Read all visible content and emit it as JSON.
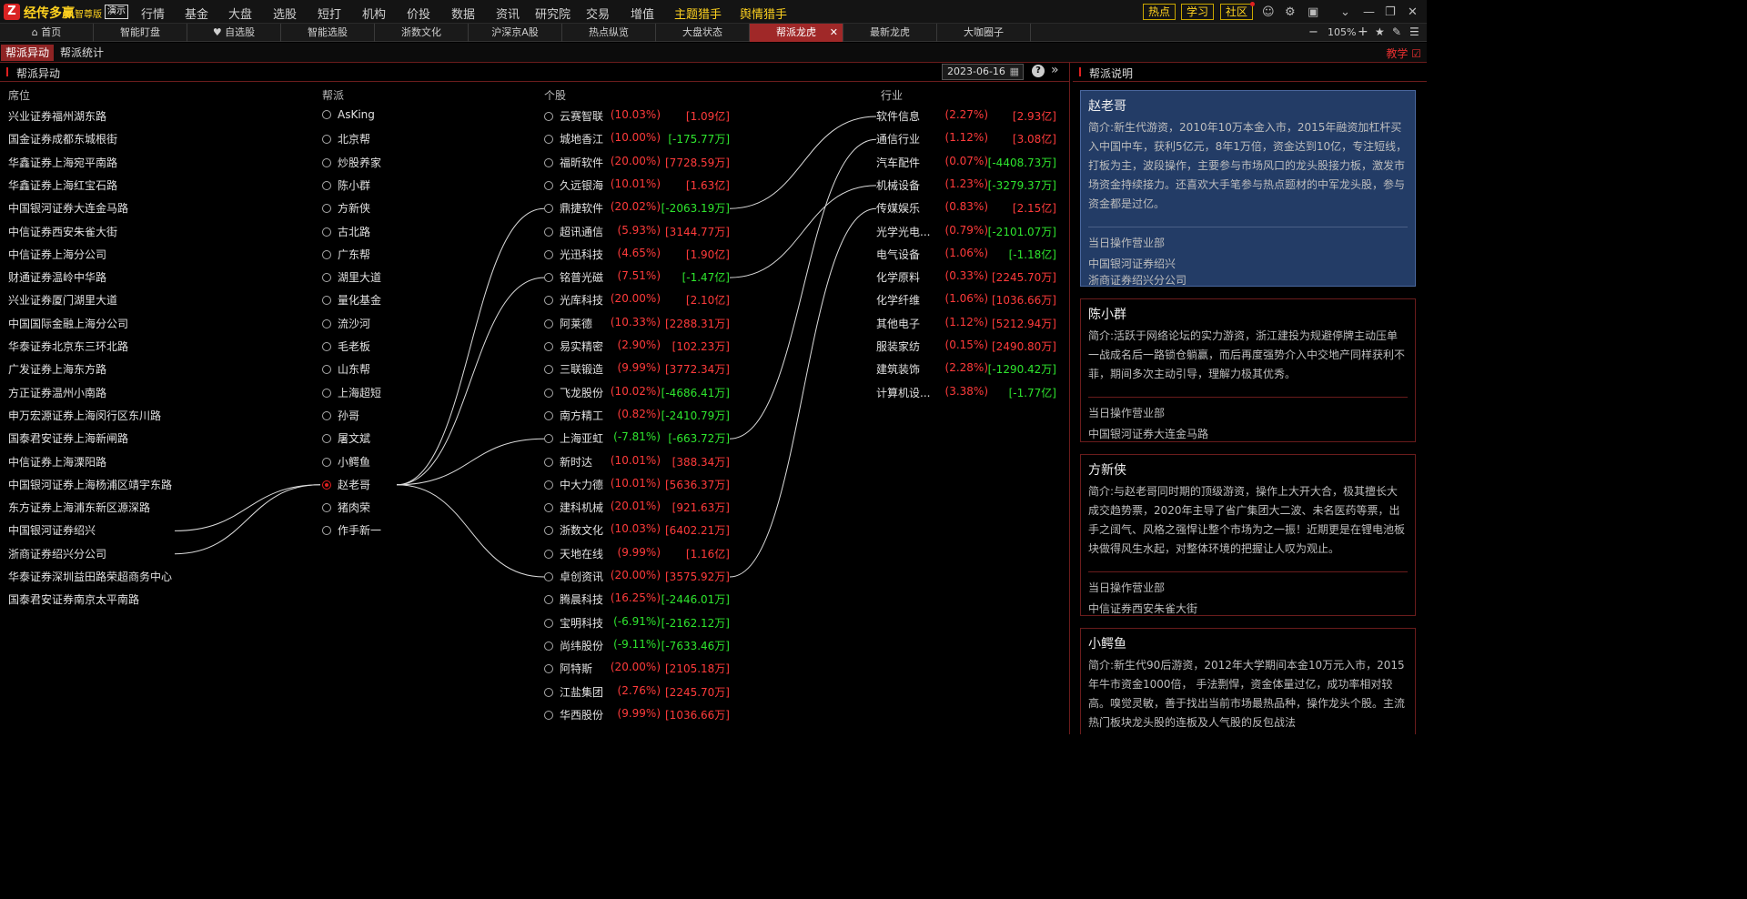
{
  "app": {
    "logo": "Z",
    "name": "经传多赢",
    "version": "智尊版",
    "demo": "演示"
  },
  "menu": [
    {
      "label": "行情",
      "dot": true
    },
    {
      "label": "基金"
    },
    {
      "label": "大盘"
    },
    {
      "label": "选股"
    },
    {
      "label": "短打"
    },
    {
      "label": "机构"
    },
    {
      "label": "价投"
    },
    {
      "label": "数据"
    },
    {
      "label": "资讯"
    },
    {
      "label": "研究院"
    },
    {
      "label": "交易"
    },
    {
      "label": "增值",
      "dot": true
    },
    {
      "label": "主题猎手",
      "dot": true,
      "yellow": true
    },
    {
      "label": "舆情猎手",
      "dot": true,
      "yellow": true
    }
  ],
  "top_buttons": [
    {
      "label": "热点"
    },
    {
      "label": "学习"
    },
    {
      "label": "社区",
      "dot": true
    }
  ],
  "tabs": [
    {
      "label": "首页"
    },
    {
      "label": "智能盯盘"
    },
    {
      "label": "自选股"
    },
    {
      "label": "智能选股"
    },
    {
      "label": "浙数文化"
    },
    {
      "label": "沪深京A股"
    },
    {
      "label": "热点纵览"
    },
    {
      "label": "大盘状态"
    },
    {
      "label": "帮派龙虎",
      "active": true
    },
    {
      "label": "最新龙虎"
    },
    {
      "label": "大咖圈子"
    }
  ],
  "zoom": "105%",
  "subtabs": [
    {
      "label": "帮派异动",
      "active": true
    },
    {
      "label": "帮派统计"
    }
  ],
  "teach_label": "教学",
  "panel": {
    "title": "帮派异动",
    "date": "2023-06-16",
    "col_seat": "席位",
    "col_gang": "帮派",
    "col_stock": "个股",
    "col_industry": "行业"
  },
  "seats": [
    "兴业证券福州湖东路",
    "国金证券成都东城根街",
    "华鑫证券上海宛平南路",
    "华鑫证券上海红宝石路",
    "中国银河证券大连金马路",
    "中信证券西安朱雀大街",
    "中信证券上海分公司",
    "财通证券温岭中华路",
    "兴业证券厦门湖里大道",
    "中国国际金融上海分公司",
    "华泰证券北京东三环北路",
    "广发证券上海东方路",
    "方正证券温州小南路",
    "申万宏源证券上海闵行区东川路",
    "国泰君安证券上海新闸路",
    "中信证券上海溧阳路",
    "中国银河证券上海杨浦区靖宇东路",
    "东方证券上海浦东新区源深路",
    "中国银河证券绍兴",
    "浙商证券绍兴分公司",
    "华泰证券深圳益田路荣超商务中心",
    "国泰君安证券南京太平南路"
  ],
  "gangs": [
    {
      "name": "AsKing"
    },
    {
      "name": "北京帮"
    },
    {
      "name": "炒股养家"
    },
    {
      "name": "陈小群"
    },
    {
      "name": "方新侠"
    },
    {
      "name": "古北路"
    },
    {
      "name": "广东帮"
    },
    {
      "name": "湖里大道"
    },
    {
      "name": "量化基金"
    },
    {
      "name": "流沙河"
    },
    {
      "name": "毛老板"
    },
    {
      "name": "山东帮"
    },
    {
      "name": "上海超短"
    },
    {
      "name": "孙哥"
    },
    {
      "name": "屠文斌"
    },
    {
      "name": "小鳄鱼"
    },
    {
      "name": "赵老哥",
      "selected": true
    },
    {
      "name": "猪肉荣"
    },
    {
      "name": "作手新一"
    }
  ],
  "stocks": [
    {
      "name": "云赛智联",
      "pct": "(10.03%)",
      "amt": "[1.09亿]",
      "pc": "red",
      "ac": "red"
    },
    {
      "name": "城地香江",
      "pct": "(10.00%)",
      "amt": "[-175.77万]",
      "pc": "red",
      "ac": "green"
    },
    {
      "name": "福昕软件",
      "pct": "(20.00%)",
      "amt": "[7728.59万]",
      "pc": "red",
      "ac": "red"
    },
    {
      "name": "久远银海",
      "pct": "(10.01%)",
      "amt": "[1.63亿]",
      "pc": "red",
      "ac": "red"
    },
    {
      "name": "鼎捷软件",
      "pct": "(20.02%)",
      "amt": "[-2063.19万]",
      "pc": "red",
      "ac": "green"
    },
    {
      "name": "超讯通信",
      "pct": "(5.93%)",
      "amt": "[3144.77万]",
      "pc": "red",
      "ac": "red"
    },
    {
      "name": "光迅科技",
      "pct": "(4.65%)",
      "amt": "[1.90亿]",
      "pc": "red",
      "ac": "red"
    },
    {
      "name": "铭普光磁",
      "pct": "(7.51%)",
      "amt": "[-1.47亿]",
      "pc": "red",
      "ac": "green"
    },
    {
      "name": "光库科技",
      "pct": "(20.00%)",
      "amt": "[2.10亿]",
      "pc": "red",
      "ac": "red"
    },
    {
      "name": "阿莱德",
      "pct": "(10.33%)",
      "amt": "[2288.31万]",
      "pc": "red",
      "ac": "red"
    },
    {
      "name": "易实精密",
      "pct": "(2.90%)",
      "amt": "[102.23万]",
      "pc": "red",
      "ac": "red"
    },
    {
      "name": "三联锻造",
      "pct": "(9.99%)",
      "amt": "[3772.34万]",
      "pc": "red",
      "ac": "red"
    },
    {
      "name": "飞龙股份",
      "pct": "(10.02%)",
      "amt": "[-4686.41万]",
      "pc": "red",
      "ac": "green"
    },
    {
      "name": "南方精工",
      "pct": "(0.82%)",
      "amt": "[-2410.79万]",
      "pc": "red",
      "ac": "green"
    },
    {
      "name": "上海亚虹",
      "pct": "(-7.81%)",
      "amt": "[-663.72万]",
      "pc": "green",
      "ac": "green"
    },
    {
      "name": "新时达",
      "pct": "(10.01%)",
      "amt": "[388.34万]",
      "pc": "red",
      "ac": "red"
    },
    {
      "name": "中大力德",
      "pct": "(10.01%)",
      "amt": "[5636.37万]",
      "pc": "red",
      "ac": "red"
    },
    {
      "name": "建科机械",
      "pct": "(20.01%)",
      "amt": "[921.63万]",
      "pc": "red",
      "ac": "red"
    },
    {
      "name": "浙数文化",
      "pct": "(10.03%)",
      "amt": "[6402.21万]",
      "pc": "red",
      "ac": "red"
    },
    {
      "name": "天地在线",
      "pct": "(9.99%)",
      "amt": "[1.16亿]",
      "pc": "red",
      "ac": "red"
    },
    {
      "name": "卓创资讯",
      "pct": "(20.00%)",
      "amt": "[3575.92万]",
      "pc": "red",
      "ac": "red"
    },
    {
      "name": "腾晨科技",
      "pct": "(16.25%)",
      "amt": "[-2446.01万]",
      "pc": "red",
      "ac": "green"
    },
    {
      "name": "宝明科技",
      "pct": "(-6.91%)",
      "amt": "[-2162.12万]",
      "pc": "green",
      "ac": "green"
    },
    {
      "name": "尚纬股份",
      "pct": "(-9.11%)",
      "amt": "[-7633.46万]",
      "pc": "green",
      "ac": "green"
    },
    {
      "name": "阿特斯",
      "pct": "(20.00%)",
      "amt": "[2105.18万]",
      "pc": "red",
      "ac": "red"
    },
    {
      "name": "江盐集团",
      "pct": "(2.76%)",
      "amt": "[2245.70万]",
      "pc": "red",
      "ac": "red"
    },
    {
      "name": "华西股份",
      "pct": "(9.99%)",
      "amt": "[1036.66万]",
      "pc": "red",
      "ac": "red"
    }
  ],
  "industries": [
    {
      "name": "软件信息",
      "pct": "(2.27%)",
      "amt": "[2.93亿]",
      "pc": "red",
      "ac": "red"
    },
    {
      "name": "通信行业",
      "pct": "(1.12%)",
      "amt": "[3.08亿]",
      "pc": "red",
      "ac": "red"
    },
    {
      "name": "汽车配件",
      "pct": "(0.07%)",
      "amt": "[-4408.73万]",
      "pc": "red",
      "ac": "green"
    },
    {
      "name": "机械设备",
      "pct": "(1.23%)",
      "amt": "[-3279.37万]",
      "pc": "red",
      "ac": "green"
    },
    {
      "name": "传媒娱乐",
      "pct": "(0.83%)",
      "amt": "[2.15亿]",
      "pc": "red",
      "ac": "red"
    },
    {
      "name": "光学光电...",
      "pct": "(0.79%)",
      "amt": "[-2101.07万]",
      "pc": "red",
      "ac": "green"
    },
    {
      "name": "电气设备",
      "pct": "(1.06%)",
      "amt": "[-1.18亿]",
      "pc": "red",
      "ac": "green"
    },
    {
      "name": "化学原料",
      "pct": "(0.33%)",
      "amt": "[2245.70万]",
      "pc": "red",
      "ac": "red"
    },
    {
      "name": "化学纤维",
      "pct": "(1.06%)",
      "amt": "[1036.66万]",
      "pc": "red",
      "ac": "red"
    },
    {
      "name": "其他电子",
      "pct": "(1.12%)",
      "amt": "[5212.94万]",
      "pc": "red",
      "ac": "red"
    },
    {
      "name": "服装家纺",
      "pct": "(0.15%)",
      "amt": "[2490.80万]",
      "pc": "red",
      "ac": "red"
    },
    {
      "name": "建筑装饰",
      "pct": "(2.28%)",
      "amt": "[-1290.42万]",
      "pc": "red",
      "ac": "green"
    },
    {
      "name": "计算机设...",
      "pct": "(3.38%)",
      "amt": "[-1.77亿]",
      "pc": "red",
      "ac": "green"
    }
  ],
  "links": {
    "seat_to_gang": [
      [
        18,
        16
      ],
      [
        19,
        16
      ]
    ],
    "gang_to_stock": [
      [
        16,
        4
      ],
      [
        16,
        7
      ],
      [
        16,
        14
      ],
      [
        16,
        20
      ]
    ],
    "stock_to_ind": [
      [
        4,
        0
      ],
      [
        7,
        3
      ],
      [
        14,
        1
      ],
      [
        20,
        4
      ]
    ]
  },
  "right": {
    "title": "帮派说明",
    "dept_label": "当日操作营业部",
    "cards": [
      {
        "name": "赵老哥",
        "intro": "简介:新生代游资，2010年10万本金入市，2015年融资加杠杆买入中国中车，获利5亿元，8年1万倍，资金达到10亿，专注短线，打板为主，波段操作，主要参与市场风口的龙头股接力板，激发市场资金持续接力。还喜欢大手笔参与热点题材的中军龙头股，参与资金都是过亿。",
        "depts": [
          "中国银河证券绍兴",
          "浙商证券绍兴分公司"
        ]
      },
      {
        "name": "陈小群",
        "intro": "简介:活跃于网络论坛的实力游资，浙江建投为规避停牌主动压单一战成名后一路锁仓躺赢，而后再度强势介入中交地产同样获利不菲，期间多次主动引导，理解力极其优秀。",
        "depts": [
          "中国银河证券大连金马路"
        ]
      },
      {
        "name": "方新侠",
        "intro": "简介:与赵老哥同时期的顶级游资，操作上大开大合，极其擅长大成交趋势票，2020年主导了省广集团大二波、未名医药等票，出手之阔气、风格之强悍让整个市场为之一振！近期更是在锂电池板块做得风生水起，对整体环境的把握让人叹为观止。",
        "depts": [
          "中信证券西安朱雀大街"
        ]
      },
      {
        "name": "小鳄鱼",
        "intro": "简介:新生代90后游资，2012年大学期间本金10万元入市，2015年牛市资金1000倍， 手法剽悍，资金体量过亿，成功率相对较高。嗅觉灵敏，善于找出当前市场最热品种，操作龙头个股。主流热门板块龙头股的连板及人气股的反包战法",
        "depts": []
      }
    ]
  }
}
